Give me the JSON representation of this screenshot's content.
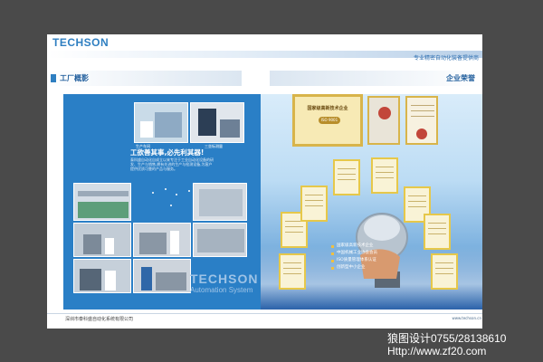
{
  "header": {
    "logo": "TECHSON",
    "slogan": "专业精密自动化装备提供商"
  },
  "left_section": {
    "title": "工厂概影",
    "subtitle": "工欲善其事,必先利其器!",
    "body": "泰科盛自动化自成立以来专注于工业自动化设备的研发、生产与销售,拥有先进的生产与检测设备,为客户提供优质可靠的产品与服务。",
    "photo_captions": [
      "生产车间",
      "三坐标测量"
    ],
    "brand_name": "TECHSON",
    "brand_tagline": "Automation System"
  },
  "right_section": {
    "title": "企业荣誉",
    "main_certificate": {
      "heading": "国家级高新技术企业",
      "seal": "ISO 9001"
    },
    "honors": [
      "国家级高新技术企业",
      "中国机械工业协会会员",
      "ISO质量管理体系认证",
      "创新型中小企业"
    ]
  },
  "footer": {
    "company": "深圳市泰科盛自动化系统有限公司",
    "right_text": "www.techson.cn"
  },
  "watermark": {
    "line1": "狼图设计0755/28138610",
    "line2": "Http://www.zf20.com"
  },
  "colors": {
    "brand_blue": "#2a7fc6",
    "gold": "#e6c84a"
  }
}
